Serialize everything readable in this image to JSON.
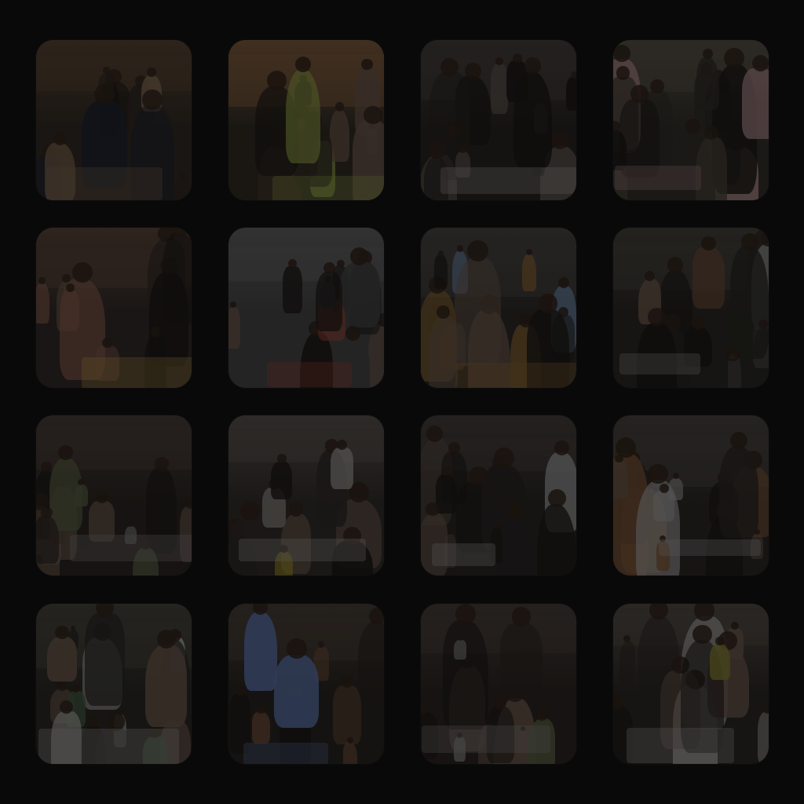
{
  "gallery": {
    "tiles": [
      {
        "scene": "classroom-speaker",
        "palette": [
          "#4a3a2c",
          "#2a241f",
          "#6e5a45",
          "#1b1f2a"
        ]
      },
      {
        "scene": "workshop-lean",
        "palette": [
          "#6a4e34",
          "#2a2620",
          "#7d8a3e",
          "#3b2f28"
        ]
      },
      {
        "scene": "outdoor-girl-white",
        "palette": [
          "#3a3634",
          "#23201e",
          "#8a8886",
          "#4d4640"
        ]
      },
      {
        "scene": "outdoor-serving",
        "palette": [
          "#4a453c",
          "#2b2924",
          "#8e6f72",
          "#3f3a31"
        ]
      },
      {
        "scene": "cooking-bowls",
        "palette": [
          "#4d3b32",
          "#2a2422",
          "#9b7f3c",
          "#6a4a3e"
        ]
      },
      {
        "scene": "courtyard-group",
        "palette": [
          "#515153",
          "#3a3a3b",
          "#8a3a2c",
          "#6e6a3a"
        ]
      },
      {
        "scene": "hall-mural",
        "palette": [
          "#3d3b38",
          "#262421",
          "#7a5a2c",
          "#5a6e8a"
        ]
      },
      {
        "scene": "children-outdoors",
        "palette": [
          "#3b3833",
          "#24221f",
          "#7f7f7f",
          "#5d4030"
        ]
      },
      {
        "scene": "hall-seated-rows",
        "palette": [
          "#3d3531",
          "#25201d",
          "#707070",
          "#4b4f3a"
        ]
      },
      {
        "scene": "food-distribution",
        "palette": [
          "#4a4541",
          "#2a2724",
          "#8c8a86",
          "#8a7a20"
        ]
      },
      {
        "scene": "selfie-group",
        "palette": [
          "#3b3633",
          "#232120",
          "#8b8b8b",
          "#4a3f38"
        ]
      },
      {
        "scene": "kids-posing",
        "palette": [
          "#3e3a37",
          "#262321",
          "#8a8787",
          "#6a4a30"
        ]
      },
      {
        "scene": "portrait-smiling",
        "palette": [
          "#3d3a33",
          "#242320",
          "#8b8a86",
          "#3a4d3a"
        ]
      },
      {
        "scene": "classroom-crowd",
        "palette": [
          "#3d3630",
          "#231f1c",
          "#4d5f8a",
          "#5a4030"
        ]
      },
      {
        "scene": "hall-seated-rows-2",
        "palette": [
          "#3d3531",
          "#25201d",
          "#707070",
          "#4b4f3a"
        ]
      },
      {
        "scene": "handing-bag",
        "palette": [
          "#45403a",
          "#262320",
          "#8a8886",
          "#6e6b2a"
        ]
      }
    ]
  }
}
